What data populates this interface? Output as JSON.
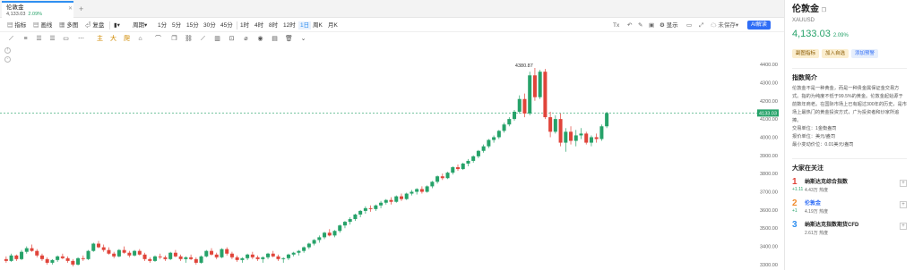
{
  "tab": {
    "name": "伦敦金",
    "price": "4,133.03",
    "change_pct": "2.09%",
    "close_icon": "close-icon",
    "add_icon": "plus-icon"
  },
  "toolbar": {
    "items": [
      "指标",
      "画线",
      "多图",
      "复盘",
      "周期",
      "1分",
      "5分",
      "15分",
      "30分",
      "45分",
      "1时",
      "4时",
      "8时",
      "12时",
      "1日",
      "周K",
      "月K"
    ],
    "active": "1日",
    "right": [
      "显示",
      "未保存"
    ],
    "ai_label": "AI解读"
  },
  "price_axis": {
    "ticks": [
      "4400.00",
      "4300.00",
      "4200.00",
      "4100.00",
      "4000.00",
      "3900.00",
      "3800.00",
      "3700.00",
      "3600.00",
      "3500.00",
      "3400.00",
      "3300.00"
    ],
    "current": "4133.03",
    "high_label": "4380.87"
  },
  "chart_data": {
    "type": "candlestick",
    "y_range": [
      3280,
      4420
    ],
    "high_marker": 4380.87,
    "current_price": 4133.03,
    "candles": [
      [
        3330,
        3345,
        3310,
        3320
      ],
      [
        3320,
        3360,
        3315,
        3350
      ],
      [
        3350,
        3355,
        3320,
        3330
      ],
      [
        3330,
        3380,
        3325,
        3370
      ],
      [
        3370,
        3400,
        3360,
        3390
      ],
      [
        3390,
        3410,
        3370,
        3375
      ],
      [
        3375,
        3385,
        3340,
        3350
      ],
      [
        3350,
        3360,
        3320,
        3330
      ],
      [
        3330,
        3340,
        3300,
        3310
      ],
      [
        3310,
        3330,
        3300,
        3325
      ],
      [
        3325,
        3350,
        3315,
        3345
      ],
      [
        3345,
        3360,
        3330,
        3335
      ],
      [
        3335,
        3345,
        3310,
        3320
      ],
      [
        3320,
        3330,
        3290,
        3300
      ],
      [
        3300,
        3340,
        3295,
        3335
      ],
      [
        3335,
        3350,
        3320,
        3330
      ],
      [
        3330,
        3380,
        3325,
        3375
      ],
      [
        3375,
        3420,
        3370,
        3415
      ],
      [
        3415,
        3430,
        3390,
        3395
      ],
      [
        3395,
        3410,
        3370,
        3380
      ],
      [
        3380,
        3395,
        3355,
        3360
      ],
      [
        3360,
        3370,
        3335,
        3345
      ],
      [
        3345,
        3385,
        3340,
        3380
      ],
      [
        3380,
        3400,
        3360,
        3365
      ],
      [
        3365,
        3375,
        3340,
        3350
      ],
      [
        3350,
        3380,
        3345,
        3375
      ],
      [
        3375,
        3385,
        3350,
        3355
      ],
      [
        3355,
        3365,
        3320,
        3330
      ],
      [
        3330,
        3340,
        3310,
        3320
      ],
      [
        3320,
        3350,
        3315,
        3345
      ],
      [
        3345,
        3360,
        3330,
        3340
      ],
      [
        3340,
        3350,
        3320,
        3330
      ],
      [
        3330,
        3370,
        3325,
        3365
      ],
      [
        3365,
        3380,
        3340,
        3345
      ],
      [
        3345,
        3355,
        3320,
        3330
      ],
      [
        3330,
        3345,
        3310,
        3340
      ],
      [
        3340,
        3355,
        3325,
        3330
      ],
      [
        3330,
        3340,
        3300,
        3310
      ],
      [
        3310,
        3350,
        3305,
        3345
      ],
      [
        3345,
        3380,
        3340,
        3375
      ],
      [
        3375,
        3390,
        3350,
        3355
      ],
      [
        3355,
        3365,
        3330,
        3340
      ],
      [
        3340,
        3390,
        3335,
        3385
      ],
      [
        3385,
        3395,
        3350,
        3360
      ],
      [
        3360,
        3370,
        3330,
        3340
      ],
      [
        3340,
        3350,
        3315,
        3325
      ],
      [
        3325,
        3340,
        3310,
        3335
      ],
      [
        3335,
        3360,
        3325,
        3355
      ],
      [
        3355,
        3370,
        3330,
        3340
      ],
      [
        3340,
        3350,
        3320,
        3330
      ],
      [
        3330,
        3345,
        3310,
        3340
      ],
      [
        3340,
        3365,
        3330,
        3360
      ],
      [
        3360,
        3375,
        3340,
        3345
      ],
      [
        3345,
        3355,
        3320,
        3330
      ],
      [
        3330,
        3340,
        3310,
        3335
      ],
      [
        3335,
        3360,
        3325,
        3355
      ],
      [
        3355,
        3370,
        3345,
        3365
      ],
      [
        3365,
        3380,
        3350,
        3375
      ],
      [
        3375,
        3400,
        3365,
        3395
      ],
      [
        3395,
        3420,
        3385,
        3415
      ],
      [
        3415,
        3440,
        3405,
        3435
      ],
      [
        3435,
        3460,
        3420,
        3450
      ],
      [
        3450,
        3480,
        3440,
        3475
      ],
      [
        3475,
        3495,
        3455,
        3460
      ],
      [
        3460,
        3490,
        3450,
        3485
      ],
      [
        3485,
        3520,
        3475,
        3515
      ],
      [
        3515,
        3540,
        3500,
        3535
      ],
      [
        3535,
        3560,
        3520,
        3550
      ],
      [
        3550,
        3580,
        3540,
        3575
      ],
      [
        3575,
        3600,
        3560,
        3595
      ],
      [
        3595,
        3620,
        3580,
        3610
      ],
      [
        3610,
        3625,
        3590,
        3605
      ],
      [
        3605,
        3630,
        3595,
        3625
      ],
      [
        3625,
        3650,
        3610,
        3640
      ],
      [
        3640,
        3660,
        3630,
        3655
      ],
      [
        3655,
        3670,
        3630,
        3645
      ],
      [
        3645,
        3680,
        3640,
        3675
      ],
      [
        3675,
        3690,
        3650,
        3660
      ],
      [
        3660,
        3695,
        3655,
        3690
      ],
      [
        3690,
        3710,
        3680,
        3700
      ],
      [
        3700,
        3720,
        3685,
        3715
      ],
      [
        3715,
        3730,
        3690,
        3700
      ],
      [
        3700,
        3735,
        3695,
        3730
      ],
      [
        3730,
        3760,
        3720,
        3755
      ],
      [
        3755,
        3790,
        3745,
        3785
      ],
      [
        3785,
        3800,
        3765,
        3775
      ],
      [
        3775,
        3810,
        3770,
        3805
      ],
      [
        3805,
        3840,
        3795,
        3835
      ],
      [
        3835,
        3850,
        3815,
        3825
      ],
      [
        3825,
        3860,
        3820,
        3855
      ],
      [
        3855,
        3880,
        3840,
        3870
      ],
      [
        3870,
        3900,
        3860,
        3895
      ],
      [
        3895,
        3930,
        3885,
        3925
      ],
      [
        3925,
        3960,
        3915,
        3950
      ],
      [
        3950,
        3990,
        3940,
        3985
      ],
      [
        3985,
        4010,
        3970,
        4000
      ],
      [
        4000,
        4040,
        3990,
        4035
      ],
      [
        4035,
        4080,
        4025,
        4070
      ],
      [
        4070,
        4110,
        4060,
        4100
      ],
      [
        4100,
        4150,
        4090,
        4140
      ],
      [
        4140,
        4230,
        4130,
        4210
      ],
      [
        4210,
        4240,
        4110,
        4130
      ],
      [
        4130,
        4360,
        4120,
        4340
      ],
      [
        4340,
        4380.87,
        4200,
        4220
      ],
      [
        4220,
        4370,
        4210,
        4360
      ],
      [
        4360,
        4375,
        4100,
        4110
      ],
      [
        4110,
        4140,
        4000,
        4030
      ],
      [
        4030,
        4120,
        4020,
        4100
      ],
      [
        4100,
        4130,
        3950,
        3970
      ],
      [
        3970,
        4050,
        3920,
        4030
      ],
      [
        4030,
        4060,
        3960,
        3980
      ],
      [
        3980,
        4040,
        3950,
        4010
      ],
      [
        4010,
        4050,
        3990,
        4020
      ],
      [
        4020,
        4030,
        3960,
        3970
      ],
      [
        3970,
        4010,
        3950,
        4000
      ],
      [
        4000,
        4020,
        3970,
        3990
      ],
      [
        3990,
        4070,
        3980,
        4060
      ],
      [
        4060,
        4140,
        4050,
        4133.03
      ]
    ]
  },
  "panel": {
    "title": "伦敦金",
    "symbol": "XAUUSD",
    "price": "4,133.03",
    "change_pct": "2.09%",
    "buttons": [
      "副图指标",
      "加入自选",
      "添加预警"
    ],
    "intro_title": "指数简介",
    "intro_text": "伦敦金不是一种黄金，而是一种贵金属保证金交易方式。指的为纯度不低于99.5%的黄金。伦敦金起始源于前数年商老。在国际市场上已有超过300年的历史，是市场上最热门的黄金投资方式，广为投资者和炒家所追捧。",
    "kv": [
      "交易单位：1金衡盎司",
      "报价单位：美元/盎司",
      "最小变动价位：0.01美元/盎司"
    ],
    "watch_title": "大家在关注",
    "watch": [
      {
        "rank": "1",
        "name": "纳斯达克综合指数",
        "change": "+1.11",
        "heat": "4.43万 热度",
        "color": "#e0443a"
      },
      {
        "rank": "2",
        "name": "伦敦金",
        "change": "+1",
        "heat": "4.19万 热度",
        "color": "#f08c2e"
      },
      {
        "rank": "3",
        "name": "纳斯达克指数期货CFD",
        "change": "",
        "heat": "2.61万 热度",
        "color": "#2f8ff0"
      }
    ]
  }
}
